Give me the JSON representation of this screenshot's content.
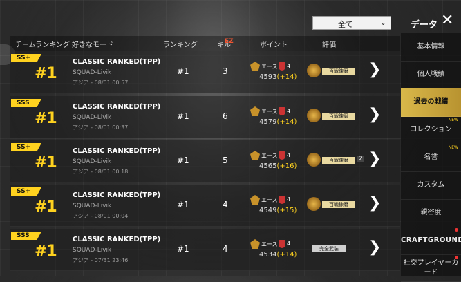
{
  "header": {
    "filter_value": "全て",
    "title": "データ",
    "columns": [
      "チームランキング",
      "好きなモード",
      "ランキング",
      "キル",
      "ポイント",
      "評価"
    ],
    "kill_badge": "EZ"
  },
  "rows": [
    {
      "grade": "SS+",
      "team_rank": "#1",
      "mode": "CLASSIC RANKED(TPP)",
      "map": "SQUAD-Livik",
      "time": "アジア - 08/01 00:57",
      "rank": "#1",
      "kills": "3",
      "tier": "エース",
      "tier_level": "4",
      "points": "4593",
      "gain": "(+14)",
      "award": "百戦錬磨",
      "extra": ""
    },
    {
      "grade": "SSS",
      "team_rank": "#1",
      "mode": "CLASSIC RANKED(TPP)",
      "map": "SQUAD-Livik",
      "time": "アジア - 08/01 00:37",
      "rank": "#1",
      "kills": "6",
      "tier": "エース",
      "tier_level": "4",
      "points": "4579",
      "gain": "(+14)",
      "award": "百戦錬磨",
      "extra": ""
    },
    {
      "grade": "SS+",
      "team_rank": "#1",
      "mode": "CLASSIC RANKED(TPP)",
      "map": "SQUAD-Livik",
      "time": "アジア - 08/01 00:18",
      "rank": "#1",
      "kills": "5",
      "tier": "エース",
      "tier_level": "4",
      "points": "4565",
      "gain": "(+16)",
      "award": "百戦錬磨",
      "extra": "2"
    },
    {
      "grade": "SS+",
      "team_rank": "#1",
      "mode": "CLASSIC RANKED(TPP)",
      "map": "SQUAD-Livik",
      "time": "アジア - 08/01 00:04",
      "rank": "#1",
      "kills": "4",
      "tier": "エース",
      "tier_level": "4",
      "points": "4549",
      "gain": "(+15)",
      "award": "百戦錬磨",
      "extra": ""
    },
    {
      "grade": "SSS",
      "team_rank": "#1",
      "mode": "CLASSIC RANKED(TPP)",
      "map": "SQUAD-Livik",
      "time": "アジア - 07/31 23:46",
      "rank": "#1",
      "kills": "4",
      "tier": "エース",
      "tier_level": "4",
      "points": "4534",
      "gain": "(+14)",
      "award": "完全武装",
      "extra": ""
    }
  ],
  "sidebar": {
    "items": [
      {
        "label": "基本情報"
      },
      {
        "label": "個人戦績"
      },
      {
        "label": "過去の戦績"
      },
      {
        "label": "コレクション",
        "badge": "NEW"
      },
      {
        "label": "名誉",
        "badge": "NEW"
      },
      {
        "label": "カスタム"
      },
      {
        "label": "親密度"
      },
      {
        "label": "CRAFTGROUND"
      },
      {
        "label": "社交プレイヤーカード"
      }
    ]
  },
  "colors": {
    "accent": "#ffd21f",
    "active_tab": "#d9b84a",
    "gain": "#ffd21f"
  }
}
